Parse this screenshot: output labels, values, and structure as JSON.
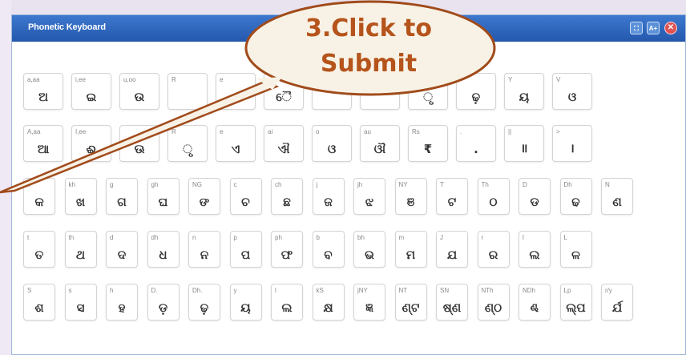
{
  "window": {
    "title": "Phonetic Keyboard",
    "buttons": {
      "expand": "⛶",
      "font": "A+",
      "close": "✕"
    }
  },
  "callout": {
    "line1": "3.Click to",
    "line2": "Submit"
  },
  "rows": [
    [
      {
        "l": "a,aa",
        "c": "ଅ"
      },
      {
        "l": "i,ee",
        "c": "ଇ"
      },
      {
        "l": "u,oo",
        "c": "ଉ"
      },
      {
        "l": "R",
        "c": ""
      },
      {
        "l": "e",
        "c": ""
      },
      {
        "l": "",
        "c": "ୈ"
      },
      {
        "l": "",
        "c": ""
      },
      {
        "l": "",
        "c": ""
      },
      {
        "l": "",
        "c": "ୃ"
      },
      {
        "l": "",
        "c": "ଢ଼"
      },
      {
        "l": "Y",
        "c": "ୟ"
      },
      {
        "l": "V",
        "c": "ଓ"
      }
    ],
    [
      {
        "l": "A,aa",
        "c": "ଆ"
      },
      {
        "l": "I,ee",
        "c": "ଈ"
      },
      {
        "l": "",
        "c": "ଊ"
      },
      {
        "l": "R",
        "c": "ୃ"
      },
      {
        "l": "e",
        "c": "ଏ"
      },
      {
        "l": "ai",
        "c": "ଐ"
      },
      {
        "l": "o",
        "c": "ଓ"
      },
      {
        "l": "au",
        "c": "ଔ"
      },
      {
        "l": "Rs",
        "c": "₹"
      },
      {
        "l": ".",
        "c": "."
      },
      {
        "l": "||",
        "c": "॥"
      },
      {
        "l": ">",
        "c": "।"
      }
    ],
    [
      {
        "l": "k",
        "c": "କ"
      },
      {
        "l": "kh",
        "c": "ଖ"
      },
      {
        "l": "g",
        "c": "ଗ"
      },
      {
        "l": "gh",
        "c": "ଘ"
      },
      {
        "l": "NG",
        "c": "ଙ"
      },
      {
        "l": "c",
        "c": "ଚ"
      },
      {
        "l": "ch",
        "c": "ଛ"
      },
      {
        "l": "j",
        "c": "ଜ"
      },
      {
        "l": "jh",
        "c": "ଝ"
      },
      {
        "l": "NY",
        "c": "ଞ"
      },
      {
        "l": "T",
        "c": "ଟ"
      },
      {
        "l": "Th",
        "c": "ଠ"
      },
      {
        "l": "D",
        "c": "ଡ"
      },
      {
        "l": "Dh",
        "c": "ଢ"
      },
      {
        "l": "N",
        "c": "ଣ"
      }
    ],
    [
      {
        "l": "t",
        "c": "ତ"
      },
      {
        "l": "th",
        "c": "ଥ"
      },
      {
        "l": "d",
        "c": "ଦ"
      },
      {
        "l": "dh",
        "c": "ଧ"
      },
      {
        "l": "n",
        "c": "ନ"
      },
      {
        "l": "p",
        "c": "ପ"
      },
      {
        "l": "ph",
        "c": "ଫ"
      },
      {
        "l": "b",
        "c": "ବ"
      },
      {
        "l": "bh",
        "c": "ଭ"
      },
      {
        "l": "m",
        "c": "ମ"
      },
      {
        "l": "J",
        "c": "ଯ"
      },
      {
        "l": "r",
        "c": "ର"
      },
      {
        "l": "l",
        "c": "ଲ"
      },
      {
        "l": "L",
        "c": "ଳ"
      }
    ],
    [
      {
        "l": "S",
        "c": "ଶ"
      },
      {
        "l": "s",
        "c": "ସ"
      },
      {
        "l": "h",
        "c": "ହ"
      },
      {
        "l": "D.",
        "c": "ଡ଼"
      },
      {
        "l": "Dh.",
        "c": "ଢ଼"
      },
      {
        "l": "y",
        "c": "ୟ"
      },
      {
        "l": "l",
        "c": "ଲ"
      },
      {
        "l": "kS",
        "c": "କ୍ଷ"
      },
      {
        "l": "jNY",
        "c": "ଜ୍ଞ"
      },
      {
        "l": "NT",
        "c": "ଣ୍ଟ"
      },
      {
        "l": "SN",
        "c": "ଷ୍ଣ"
      },
      {
        "l": "NTh",
        "c": "ଣ୍ଠ"
      },
      {
        "l": "NDh",
        "c": "ଣ୍ଢ"
      },
      {
        "l": "Lp",
        "c": "ଲ୍ପ"
      },
      {
        "l": "r/y",
        "c": "ର୍ଯ"
      }
    ]
  ]
}
